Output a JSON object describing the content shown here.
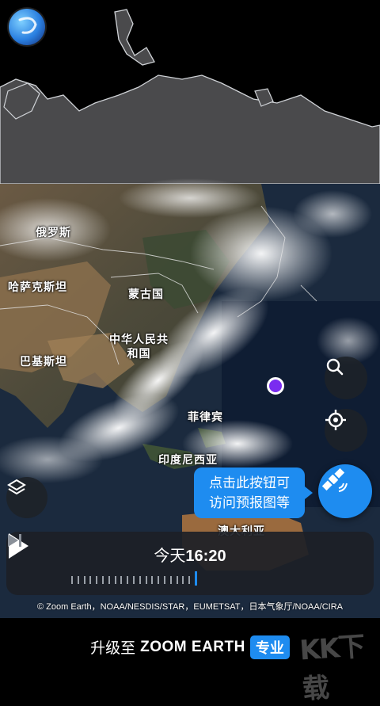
{
  "labels": {
    "russia": "俄罗斯",
    "kazakhstan": "哈萨克斯坦",
    "mongolia": "蒙古国",
    "china": "中华人民共\n和国",
    "pakistan": "巴基斯坦",
    "philippines": "菲律宾",
    "indonesia": "印度尼西亚",
    "australia": "澳大利亚"
  },
  "tooltip": {
    "line1": "点击此按钮可",
    "line2": "访问预报图等"
  },
  "timeline": {
    "day": "今天",
    "time": "16:20",
    "current_tick_index": 20,
    "tick_count": 21
  },
  "attribution": "© Zoom Earth，NOAA/NESDIS/STAR，EUMETSAT，日本气象厅/NOAA/CIRA",
  "promo": {
    "prefix": "升级至",
    "brand": "ZOOM EARTH",
    "badge": "专业"
  },
  "watermark": "KK下载",
  "icons": {
    "logo": "zoom-earth-logo-icon",
    "search": "search-icon",
    "locate": "crosshair-icon",
    "layers": "layers-icon",
    "satellite": "satellite-icon",
    "play": "play-icon",
    "skip": "skip-to-end-icon"
  },
  "colors": {
    "accent": "#1e8cf0",
    "location": "#7a2cf0"
  }
}
